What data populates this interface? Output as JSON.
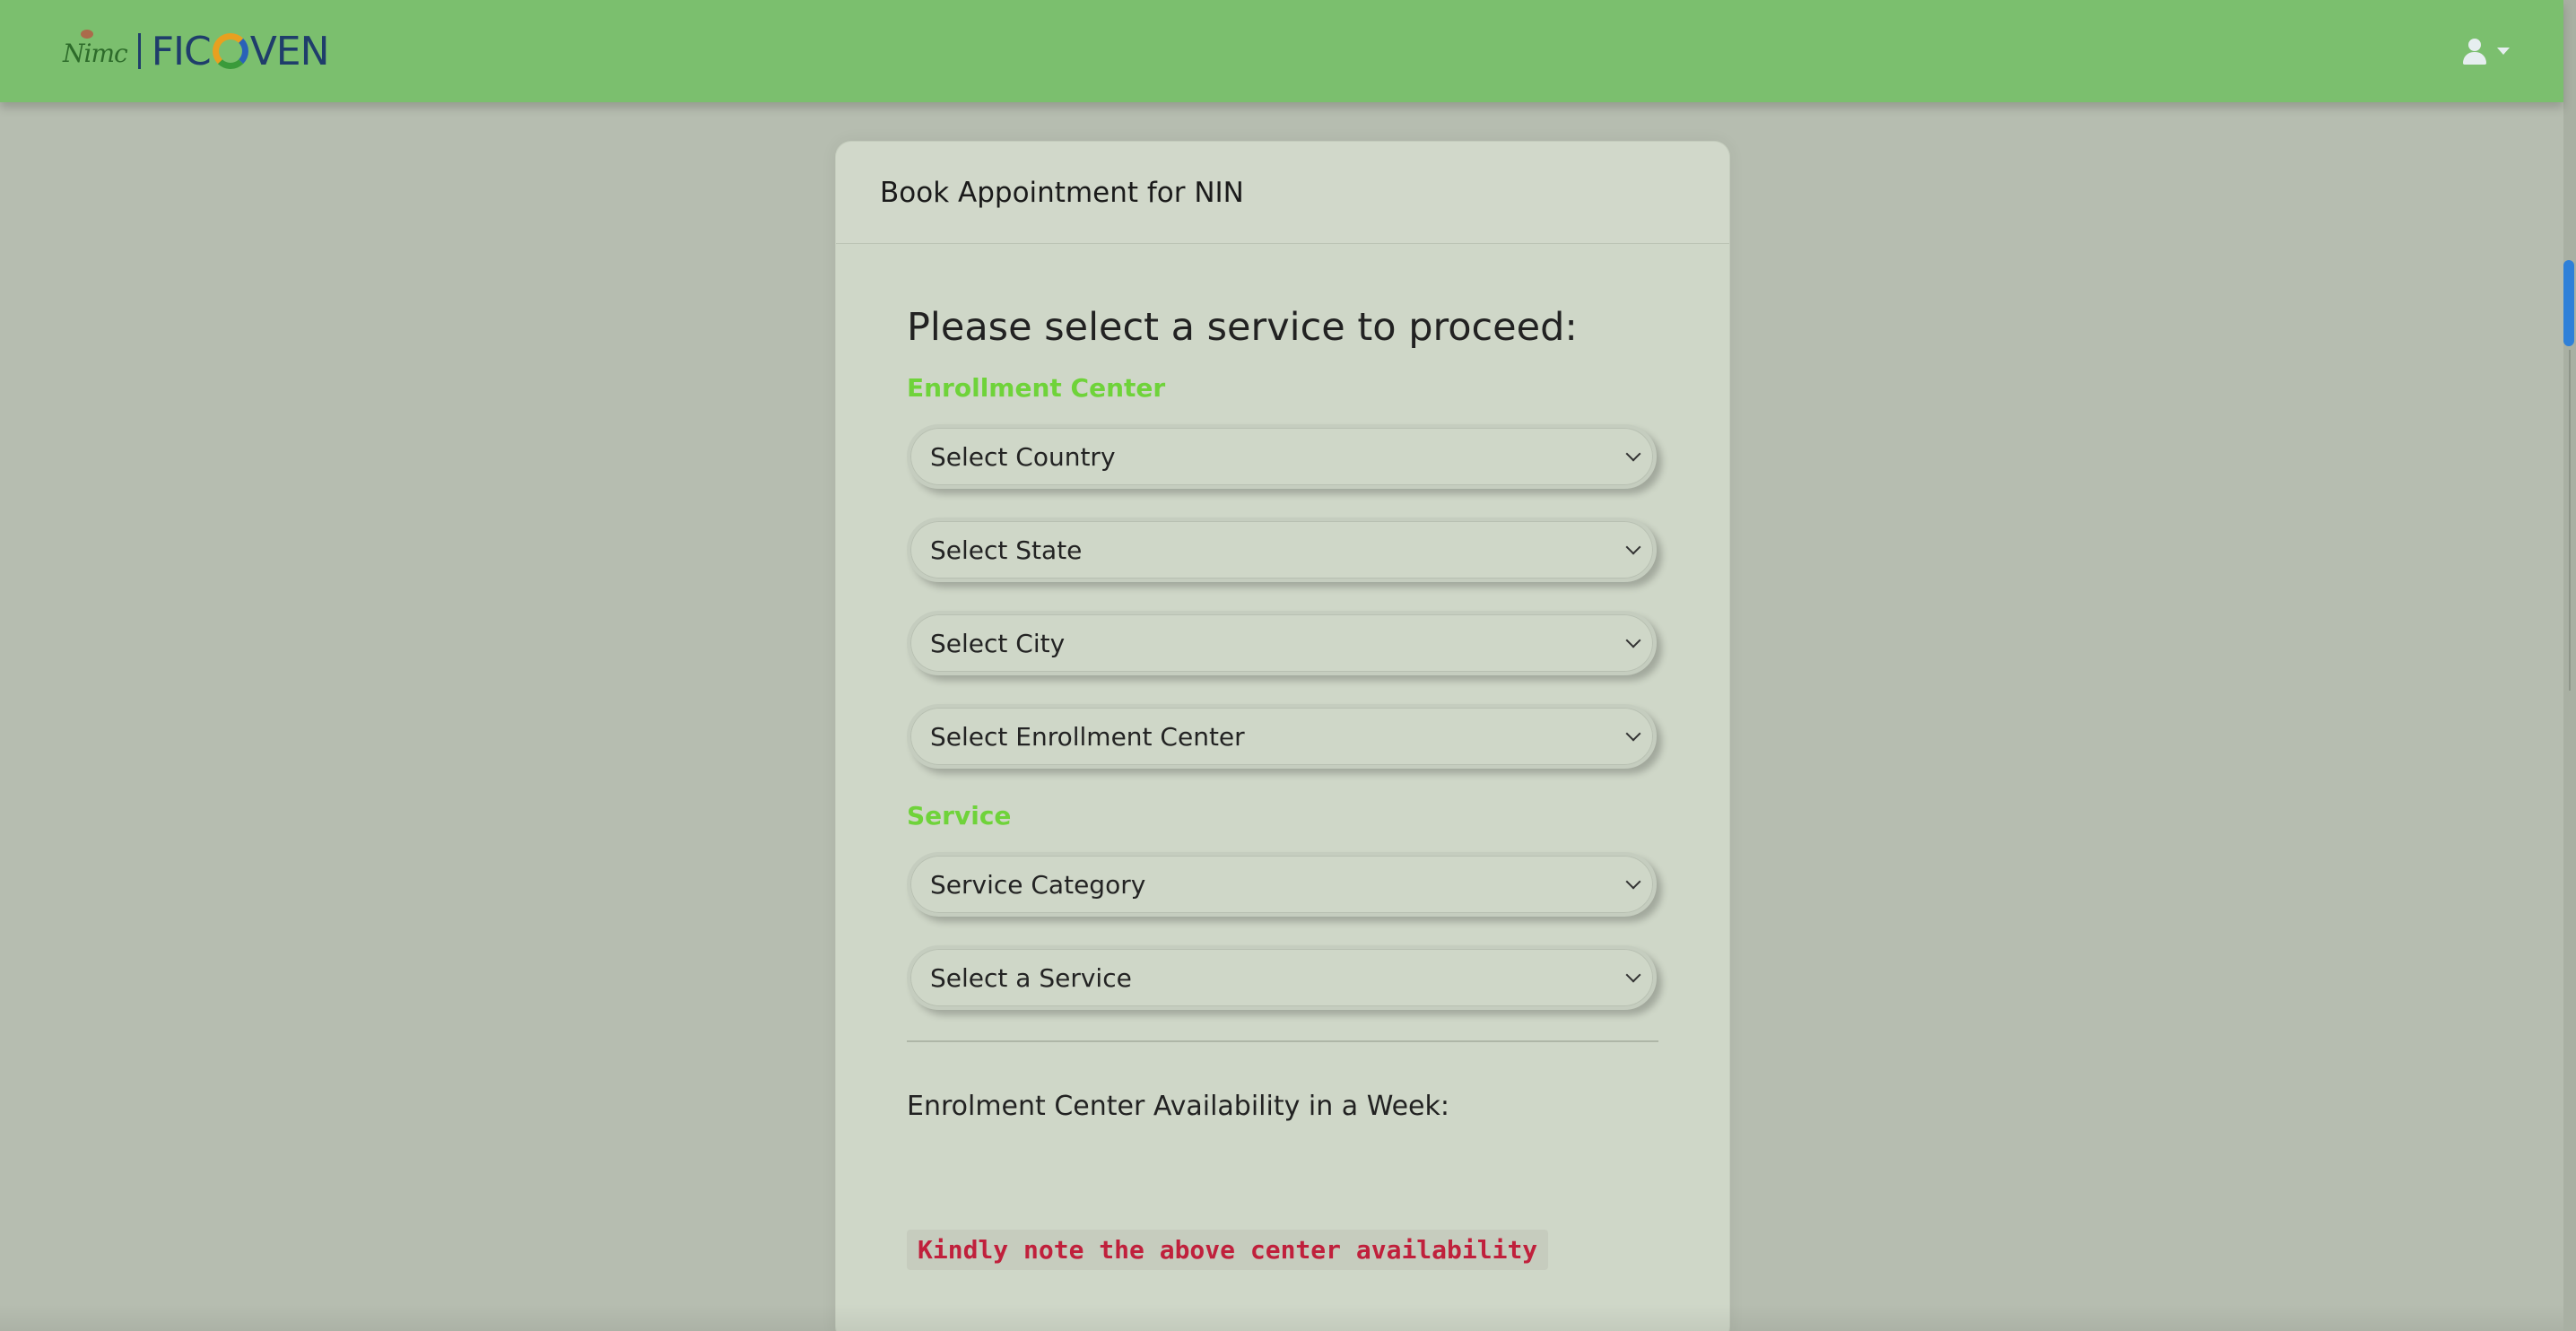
{
  "navbar": {
    "logo_text": "Nimc",
    "brand_left": "FIC",
    "brand_right": "VEN"
  },
  "card": {
    "title": "Book Appointment for NIN",
    "lead": "Please select a service to proceed:",
    "enrollment_section_label": "Enrollment Center",
    "selects": {
      "country": "Select Country",
      "state": "Select State",
      "city": "Select City",
      "center": "Select Enrollment Center",
      "service_category": "Service Category",
      "service": "Select a Service"
    },
    "service_section_label": "Service",
    "availability_label": "Enrolment Center Availability in a Week:",
    "note": "Kindly note the above center availability"
  },
  "colors": {
    "navbar": "#7bbf6e",
    "section_label": "#6fd33a",
    "note_text": "#c0203c",
    "scrollbar_thumb": "#2f80d8"
  },
  "icons": [
    "user-icon",
    "caret-down-icon",
    "chevron-down-icon"
  ]
}
